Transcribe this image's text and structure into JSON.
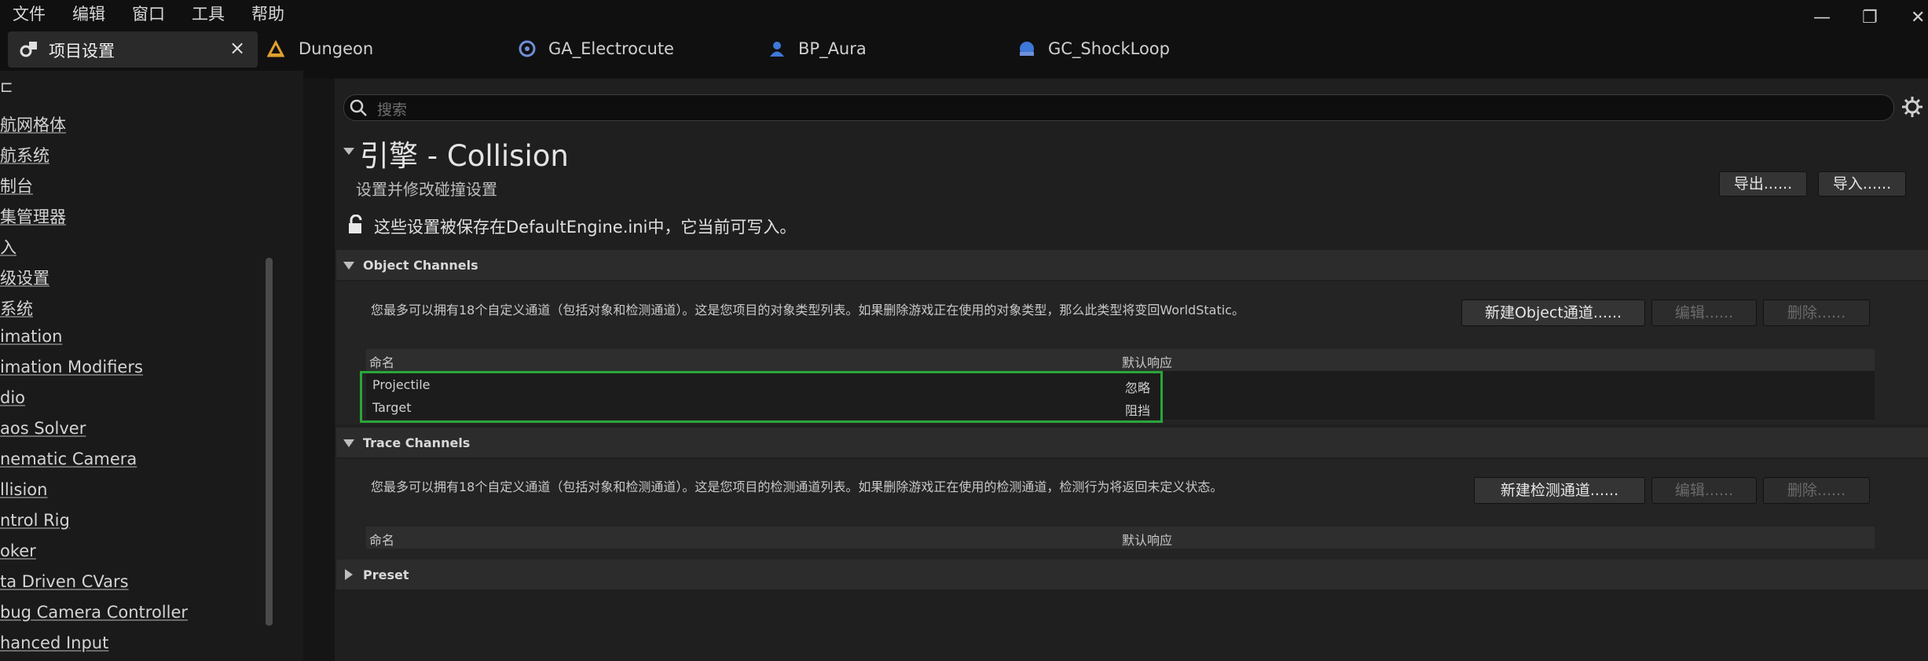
{
  "menu": [
    "文件",
    "编辑",
    "窗口",
    "工具",
    "帮助"
  ],
  "window_controls": {
    "minimize": "—",
    "restore": "❐",
    "close": "✕"
  },
  "tabs": [
    {
      "label": "项目设置",
      "active": true,
      "close": "×"
    },
    {
      "label": "Dungeon",
      "active": false
    },
    {
      "label": "GA_Electrocute",
      "active": false
    },
    {
      "label": "BP_Aura",
      "active": false
    },
    {
      "label": "GC_ShockLoop",
      "active": false
    }
  ],
  "sidebar": {
    "items": [
      "航网格体",
      "航系统",
      "制台",
      "集管理器",
      "入",
      "级设置",
      "系统",
      "imation",
      "imation Modifiers",
      "dio",
      "aos Solver",
      "nematic Camera",
      "llision",
      "ntrol Rig",
      "oker",
      "ta Driven CVars",
      "bug Camera Controller",
      "hanced Input"
    ]
  },
  "search": {
    "placeholder": "搜索"
  },
  "header": {
    "title": "引擎 - Collision",
    "subtitle": "设置并修改碰撞设置",
    "export_label": "导出......",
    "import_label": "导入......",
    "config_notice": "这些设置被保存在DefaultEngine.ini中，它当前可写入。"
  },
  "object_channels": {
    "title": "Object Channels",
    "description": "您最多可以拥有18个自定义通道（包括对象和检测通道）。这是您项目的对象类型列表。如果删除游戏正在使用的对象类型，那么此类型将变回WorldStatic。",
    "new_label": "新建Object通道......",
    "edit_label": "编辑......",
    "delete_label": "删除......",
    "columns": [
      "命名",
      "默认响应"
    ],
    "rows": [
      {
        "name": "Projectile",
        "response": "忽略"
      },
      {
        "name": "Target",
        "response": "阻挡"
      }
    ]
  },
  "trace_channels": {
    "title": "Trace Channels",
    "description": "您最多可以拥有18个自定义通道（包括对象和检测通道）。这是您项目的检测通道列表。如果删除游戏正在使用的检测通道，检测行为将返回未定义状态。",
    "new_label": "新建检测通道......",
    "edit_label": "编辑......",
    "delete_label": "删除......",
    "columns": [
      "命名",
      "默认响应"
    ]
  },
  "preset": {
    "title": "Preset"
  },
  "colors": {
    "highlight_box": "#2aa53a",
    "background": "#151515"
  }
}
